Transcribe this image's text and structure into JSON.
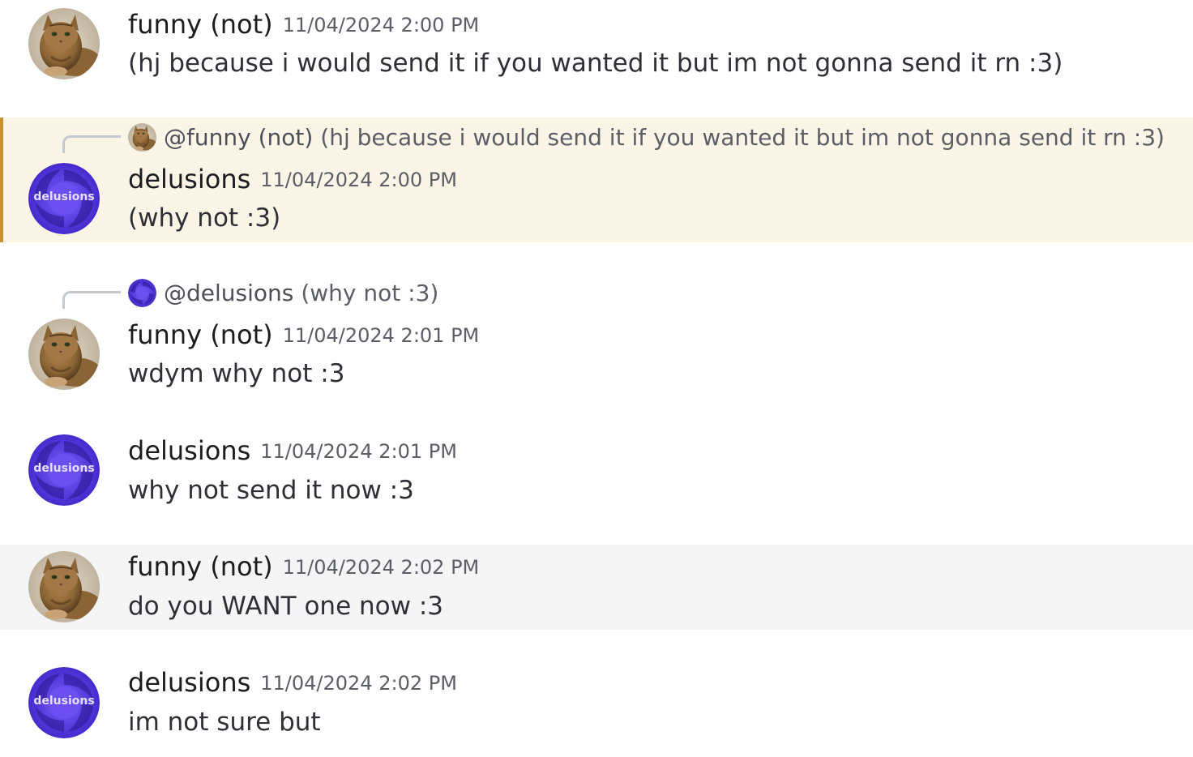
{
  "messages": [
    {
      "author": "funny (not)",
      "timestamp": "11/04/2024 2:00 PM",
      "content": "(hj because i would send it if you wanted it but im not gonna send it rn :3)",
      "avatar": "cat-avatar"
    },
    {
      "author": "delusions",
      "timestamp": "11/04/2024 2:00 PM",
      "content": "(why not :3)",
      "avatar": "delusions-avatar",
      "reply_to": {
        "author": "@funny (not)",
        "content": "(hj because i would send it if you wanted it but im not gonna send it rn :3)",
        "avatar": "cat-avatar"
      }
    },
    {
      "author": "funny (not)",
      "timestamp": "11/04/2024 2:01 PM",
      "content": "wdym why not :3",
      "avatar": "cat-avatar",
      "reply_to": {
        "author": "@delusions",
        "content": "(why not :3)",
        "avatar": "delusions-avatar"
      }
    },
    {
      "author": "delusions",
      "timestamp": "11/04/2024 2:01 PM",
      "content": "why not send it now :3",
      "avatar": "delusions-avatar"
    },
    {
      "author": "funny (not)",
      "timestamp": "11/04/2024 2:02 PM",
      "content": "do you WANT one now :3",
      "avatar": "cat-avatar"
    },
    {
      "author": "delusions",
      "timestamp": "11/04/2024 2:02 PM",
      "content": "im not sure but",
      "avatar": "delusions-avatar"
    }
  ],
  "avatar_logo_text": "delusions",
  "colors": {
    "highlight_bg": "#fbf5e7",
    "highlight_bar": "#c8932b",
    "hover_bg": "#f5f5f6",
    "delusions_purple": "#5b3fe0"
  }
}
